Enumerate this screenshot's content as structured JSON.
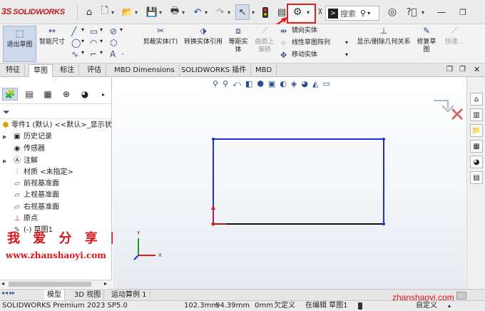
{
  "app": {
    "logo_text": "SOLIDWORKS",
    "logo_prefix": "3S"
  },
  "titlebar": {
    "icons": [
      "home-icon",
      "new-document-icon",
      "chevron-down-icon",
      "open-icon",
      "chevron-down-icon",
      "save-icon",
      "chevron-down-icon",
      "print-icon",
      "chevron-down-icon",
      "undo-icon",
      "chevron-down-icon",
      "redo-icon",
      "chevron-down-icon",
      "select-icon",
      "chevron-down-icon",
      "rebuild-traffic-light-icon",
      "file-properties-icon",
      "options-gear-icon",
      "chevron-down-icon",
      "pin-icon"
    ],
    "search_placeholder": "搜索",
    "help_icons": [
      "user-icon",
      "help-icon",
      "chevron-down-icon",
      "minimize-icon",
      "restore-icon"
    ]
  },
  "ribbon": {
    "exit_sketch": "退出草图",
    "smart_dim": "智能尺寸",
    "trim": "剪裁实体(T)",
    "convert": "转换实体引用",
    "offset": "等距实体",
    "surface_offset": "曲面上偏移",
    "mirror": "镜向实体",
    "linear_pattern": "线性草图阵列",
    "move": "移动实体",
    "show_relations": "显示/删除几何关系",
    "repair": "修复草图",
    "rapid": "快速..."
  },
  "tabs": [
    "特征",
    "草图",
    "标注",
    "评估",
    "MBD Dimensions",
    "SOLIDWORKS 插件",
    "MBD"
  ],
  "active_tab": 1,
  "tree": {
    "root": "零件1 (默认) <<默认>_显示状",
    "items": [
      {
        "label": "历史记录",
        "icon": "history-icon",
        "expandable": true
      },
      {
        "label": "传感器",
        "icon": "sensor-icon",
        "expandable": false
      },
      {
        "label": "注解",
        "icon": "annotation-icon",
        "expandable": true
      },
      {
        "label": "材质 <未指定>",
        "icon": "material-icon",
        "expandable": false
      },
      {
        "label": "前视基准面",
        "icon": "plane-icon",
        "expandable": false
      },
      {
        "label": "上视基准面",
        "icon": "plane-icon",
        "expandable": false
      },
      {
        "label": "右视基准面",
        "icon": "plane-icon",
        "expandable": false
      },
      {
        "label": "原点",
        "icon": "origin-icon",
        "expandable": false
      },
      {
        "label": "(-) 草图1",
        "icon": "sketch-icon",
        "expandable": false
      }
    ]
  },
  "watermark": {
    "cn": "我 爱 分 享 网",
    "url": "www.zhanshaoyi.com",
    "url2": "zhanshaoyi.com"
  },
  "bottom_tabs": [
    "模型",
    "3D 视图",
    "运动算例 1"
  ],
  "active_bottom_tab": 0,
  "status": {
    "product": "SOLIDWORKS Premium 2023 SP5.0",
    "x": "102.3mm",
    "y": "94.39mm",
    "z": "0mm",
    "state": "欠定义",
    "editing": "在编辑 草图1",
    "custom": "自定义"
  },
  "colors": {
    "sketch_blue": "#1f2fd8",
    "sketch_black": "#111111",
    "origin_red": "#d82020",
    "highlight": "#e2231a",
    "watermark": "#d9161c"
  }
}
